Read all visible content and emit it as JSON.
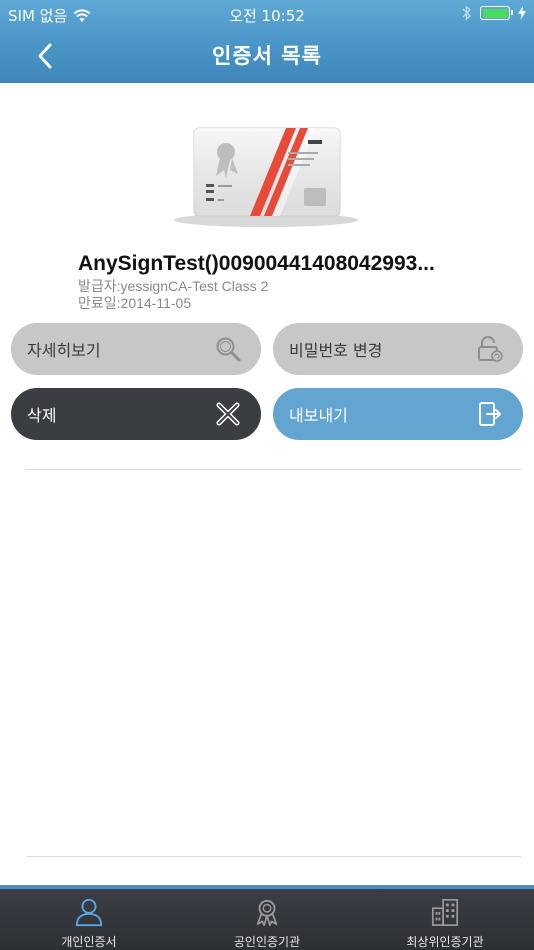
{
  "status_bar": {
    "carrier": "SIM 없음",
    "time": "오전 10:52"
  },
  "nav": {
    "title": "인증서 목록",
    "back_icon": "chevron-left-icon"
  },
  "certificate": {
    "name": "AnySignTest()00900441408042993...",
    "issuer": "발급자:yessignCA-Test Class 2",
    "expiry": "만료일:2014-11-05"
  },
  "actions": {
    "detail": {
      "label": "자세히보기",
      "icon": "search-icon"
    },
    "password": {
      "label": "비밀번호 변경",
      "icon": "unlock-icon"
    },
    "delete": {
      "label": "삭제",
      "icon": "close-icon"
    },
    "export": {
      "label": "내보내기",
      "icon": "export-icon"
    }
  },
  "tabs": [
    {
      "label": "개인인증서",
      "icon": "person-icon",
      "active": true
    },
    {
      "label": "공인인증기관",
      "icon": "ribbon-icon",
      "active": false
    },
    {
      "label": "최상위인증기관",
      "icon": "building-icon",
      "active": false
    }
  ],
  "colors": {
    "header": "#4a95c7",
    "accent": "#62a5d1",
    "dark_button": "#3a3d42",
    "gray_button": "#c7c7c7",
    "tab_active": "#5aa8e0"
  }
}
